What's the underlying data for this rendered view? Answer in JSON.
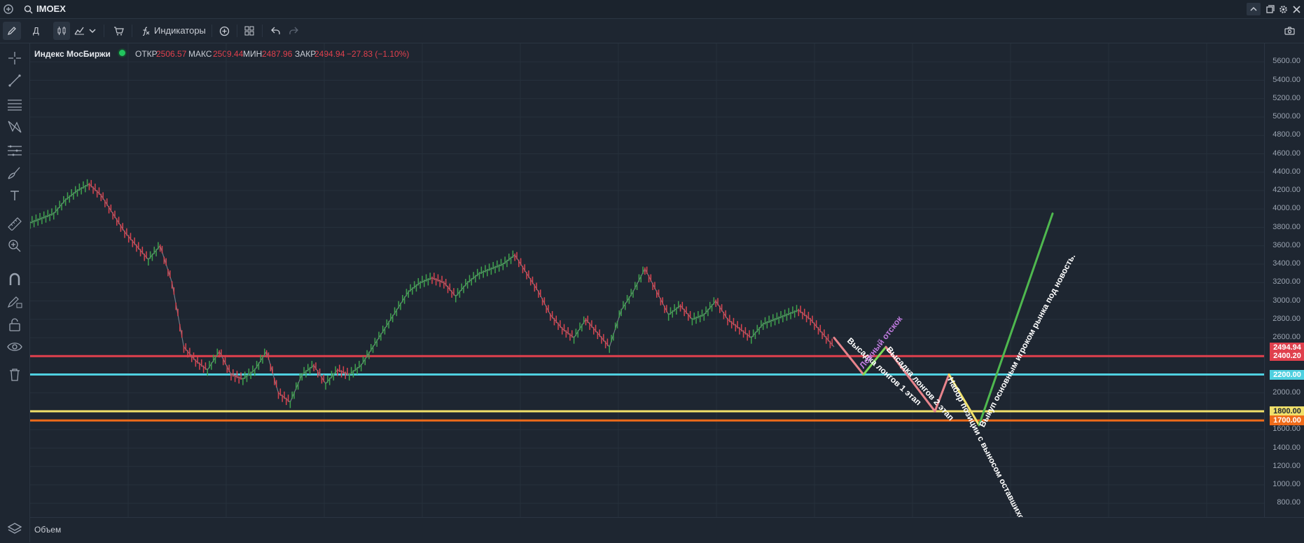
{
  "header": {
    "symbol": "IMOEX"
  },
  "toolbar": {
    "interval_label": "Д",
    "indicators_label": "Индикаторы"
  },
  "legend": {
    "name": "Индекс МосБиржи",
    "open_label": "ОТКР",
    "open_value": "2506.57",
    "high_label": "МАКС",
    "high_value": "2509.44",
    "low_label": "МИН",
    "low_value": "2487.96",
    "close_label": "ЗАКР",
    "close_value": "2494.94",
    "change_value": "−27.83 (−1.10%)"
  },
  "volume_label": "Объем",
  "chart_data": {
    "type": "line",
    "ylim": [
      650,
      5800
    ],
    "price_ticks": [
      "5600.00",
      "5400.00",
      "5200.00",
      "5000.00",
      "4800.00",
      "4600.00",
      "4400.00",
      "4200.00",
      "4000.00",
      "3800.00",
      "3600.00",
      "3400.00",
      "3200.00",
      "3000.00",
      "2800.00",
      "2600.00",
      "2400.00",
      "2200.00",
      "2000.00",
      "1800.00",
      "1600.00",
      "1400.00",
      "1200.00",
      "1000.00",
      "800.00"
    ],
    "series": [
      {
        "values": [
          3850,
          3900,
          3950,
          4100,
          4200,
          4270,
          4150,
          3950,
          3750,
          3600,
          3450,
          3600,
          3200,
          2500,
          2350,
          2250,
          2450,
          2200,
          2150,
          2250,
          2450,
          2000,
          1900,
          2200,
          2300,
          2100,
          2250,
          2200,
          2300,
          2500,
          2700,
          2900,
          3100,
          3200,
          3250,
          3200,
          3050,
          3200,
          3300,
          3350,
          3400,
          3500,
          3300,
          3100,
          2850,
          2700,
          2600,
          2800,
          2650,
          2500,
          2900,
          3100,
          3350,
          3100,
          2850,
          2950,
          2800,
          2850,
          3000,
          2800,
          2700,
          2600,
          2750,
          2800,
          2850,
          2900,
          2800,
          2650,
          2500
        ]
      }
    ],
    "levels": [
      {
        "value": 2400.2,
        "label": "2400.20",
        "color": "#e0404d"
      },
      {
        "value": 2200.0,
        "label": "2200.00",
        "color": "#4fd0e0"
      },
      {
        "value": 1800.0,
        "label": "1800.00",
        "color": "#f0e06a"
      },
      {
        "value": 1700.0,
        "label": "1700.00",
        "color": "#ef6b1a"
      }
    ],
    "last_price": {
      "label": "2494.94",
      "color": "#e0404d"
    },
    "annotations": [
      {
        "text": "Высадка лонгов  1 этап",
        "color": "#ffffff"
      },
      {
        "text": "Ложный отскок",
        "color": "#c07be0"
      },
      {
        "text": "Высадка лонгов 2 этап",
        "color": "#ffffff"
      },
      {
        "text": "Набор позиции с выносом оставшихся",
        "color": "#ffffff"
      },
      {
        "text": "Выкуп основным игроком рынка под новость.",
        "color": "#ffffff"
      }
    ],
    "projection": [
      {
        "from": 2600,
        "to": 2200,
        "color": "#e8848c"
      },
      {
        "from": 2200,
        "to": 2500,
        "color": "#7ed957"
      },
      {
        "from": 2500,
        "to": 1800,
        "color": "#e8848c"
      },
      {
        "from": 1800,
        "to": 2200,
        "color": "#e8848c"
      },
      {
        "from": 2200,
        "to": 1650,
        "color": "#f0e06a"
      },
      {
        "from": 1650,
        "to": 3950,
        "color": "#4fb84f"
      }
    ]
  }
}
